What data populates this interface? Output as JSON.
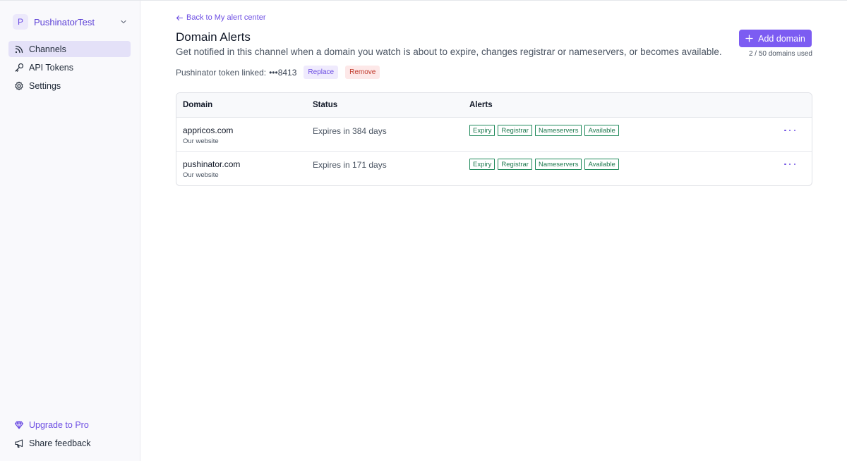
{
  "workspace": {
    "initial": "P",
    "name": "PushinatorTest"
  },
  "sidebar": {
    "items": [
      {
        "label": "Channels",
        "icon": "rss-icon",
        "active": true
      },
      {
        "label": "API Tokens",
        "icon": "key-icon",
        "active": false
      },
      {
        "label": "Settings",
        "icon": "gear-icon",
        "active": false
      }
    ],
    "bottom": {
      "upgrade_label": "Upgrade to Pro",
      "feedback_label": "Share feedback"
    }
  },
  "header": {
    "back_label": "Back to My alert center",
    "title": "Domain Alerts",
    "subtitle": "Get notified in this channel when a domain you watch is about to expire, changes registrar or nameservers, or becomes available.",
    "add_button_label": "Add domain",
    "usage": "2 / 50 domains used"
  },
  "token": {
    "label": "Pushinator token linked:",
    "value": "•••8413",
    "replace_label": "Replace",
    "remove_label": "Remove"
  },
  "table": {
    "columns": [
      "Domain",
      "Status",
      "Alerts"
    ],
    "rows": [
      {
        "domain": "appricos.com",
        "note": "Our website",
        "status": "Expires in 384 days",
        "alerts": [
          "Expiry",
          "Registrar",
          "Nameservers",
          "Available"
        ]
      },
      {
        "domain": "pushinator.com",
        "note": "Our website",
        "status": "Expires in 171 days",
        "alerts": [
          "Expiry",
          "Registrar",
          "Nameservers",
          "Available"
        ]
      }
    ]
  },
  "colors": {
    "accent": "#7c5cf2",
    "tag_green": "#1f8a5b",
    "remove_red": "#c0392b"
  }
}
